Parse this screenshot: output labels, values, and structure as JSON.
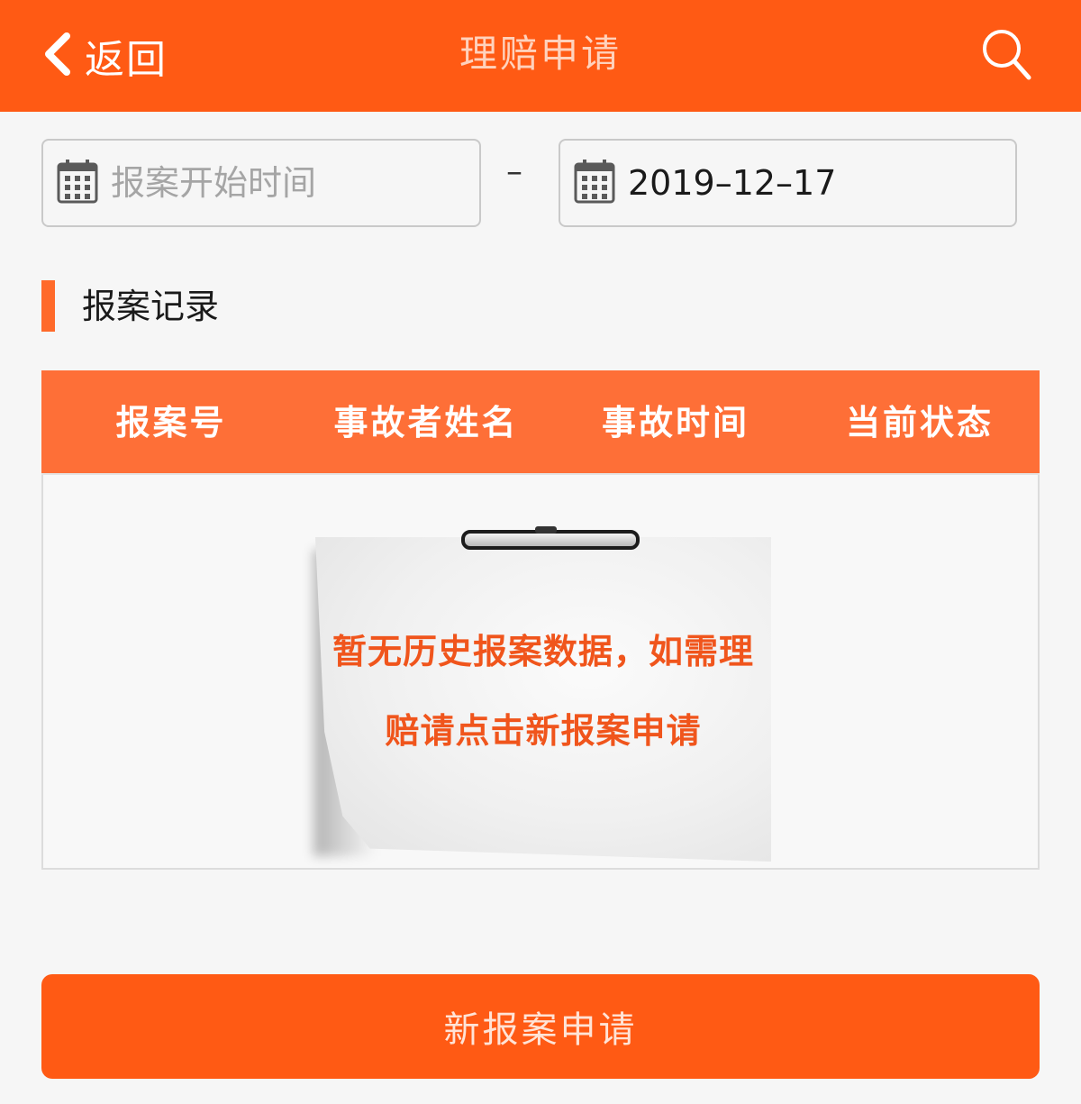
{
  "header": {
    "back_label": "返回",
    "title": "理赔申请",
    "back_icon": "chevron-left-icon",
    "search_icon": "search-icon"
  },
  "filters": {
    "start_placeholder": "报案开始时间",
    "start_value": "",
    "separator": "–",
    "end_value": "2019–12–17",
    "calendar_icon": "calendar-icon"
  },
  "section": {
    "title": "报案记录"
  },
  "table": {
    "columns": [
      "报案号",
      "事故者姓名",
      "事故时间",
      "当前状态"
    ],
    "rows": [],
    "empty_message_lines": [
      "暂无历史报案数据，如需理",
      "赔请点击新报案申请"
    ]
  },
  "actions": {
    "new_claim_label": "新报案申请"
  },
  "colors": {
    "brand": "#ff5a14",
    "table_header": "#fe6f37",
    "empty_text": "#f0551c"
  }
}
